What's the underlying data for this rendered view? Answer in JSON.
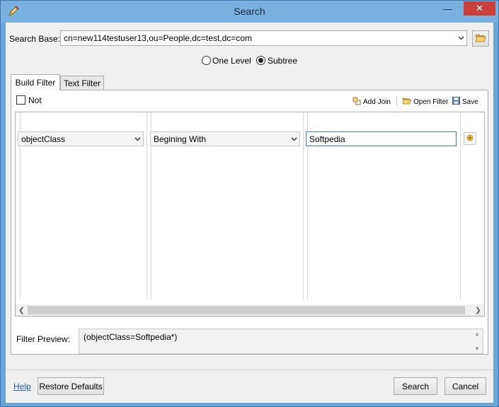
{
  "window": {
    "title": "Search",
    "minimize_glyph": "—",
    "close_glyph": "✕"
  },
  "search_base": {
    "label": "Search Base:",
    "value": "cn=new114testuser13,ou=People,dc=test,dc=com"
  },
  "scope": {
    "options": [
      {
        "label": "One Level",
        "checked": false
      },
      {
        "label": "Subtree",
        "checked": true
      }
    ]
  },
  "tabs": [
    {
      "label": "Build Filter",
      "active": true
    },
    {
      "label": "Text Filter",
      "active": false
    }
  ],
  "build_filter": {
    "not_label": "Not",
    "not_checked": false,
    "toolbar": {
      "add_join": "Add Join",
      "open_filter": "Open Filter",
      "save": "Save"
    },
    "row": {
      "attribute": "objectClass",
      "operator": "Begining With",
      "value": "Softpedia"
    }
  },
  "filter_preview": {
    "label": "Filter Preview:",
    "value": "(objectClass=Softpedia*)"
  },
  "footer": {
    "help": "Help",
    "restore_defaults": "Restore Defaults",
    "search": "Search",
    "cancel": "Cancel"
  },
  "colors": {
    "titlebar": "#78b0e0",
    "close_button": "#c7413a",
    "link": "#1a5fb4",
    "focus_border": "#3c7fb1"
  }
}
